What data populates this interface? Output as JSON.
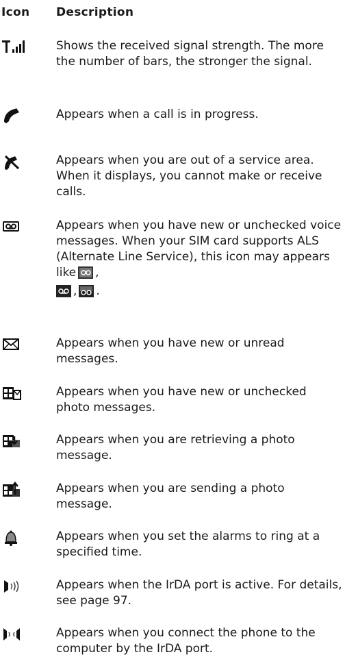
{
  "header": {
    "icon_col": "Icon",
    "description_col": "Description"
  },
  "rows": [
    {
      "icon": "signal-strength-icon",
      "text": "Shows the received signal strength. The more the number of bars, the stronger the signal."
    },
    {
      "icon": "call-in-progress-icon",
      "text": "Appears when a call is in progress."
    },
    {
      "icon": "no-service-icon",
      "text": "Appears when you are out of a service area. When it displays, you cannot make or receive calls."
    },
    {
      "icon": "voicemail-icon",
      "text_before": "Appears when you have new or unchecked voice messages. When your SIM card supports ALS (Alternate Line Service), this icon may appears like",
      "sep1": ",",
      "sep2": ",",
      "end": "."
    },
    {
      "icon": "envelope-icon",
      "text": "Appears when you have new or unread messages."
    },
    {
      "icon": "photo-message-icon",
      "text": "Appears when you have new or unchecked photo messages."
    },
    {
      "icon": "photo-retrieve-icon",
      "text": "Appears when you are retrieving a photo message."
    },
    {
      "icon": "photo-send-icon",
      "text": "Appears when you are sending a photo message."
    },
    {
      "icon": "alarm-icon",
      "text": "Appears when you set the alarms to ring at a specified time."
    },
    {
      "icon": "irda-active-icon",
      "text": "Appears when the IrDA port is active. For details, see page 97."
    },
    {
      "icon": "irda-connected-icon",
      "text": "Appears when you connect the phone to the computer by the IrDA port."
    }
  ]
}
